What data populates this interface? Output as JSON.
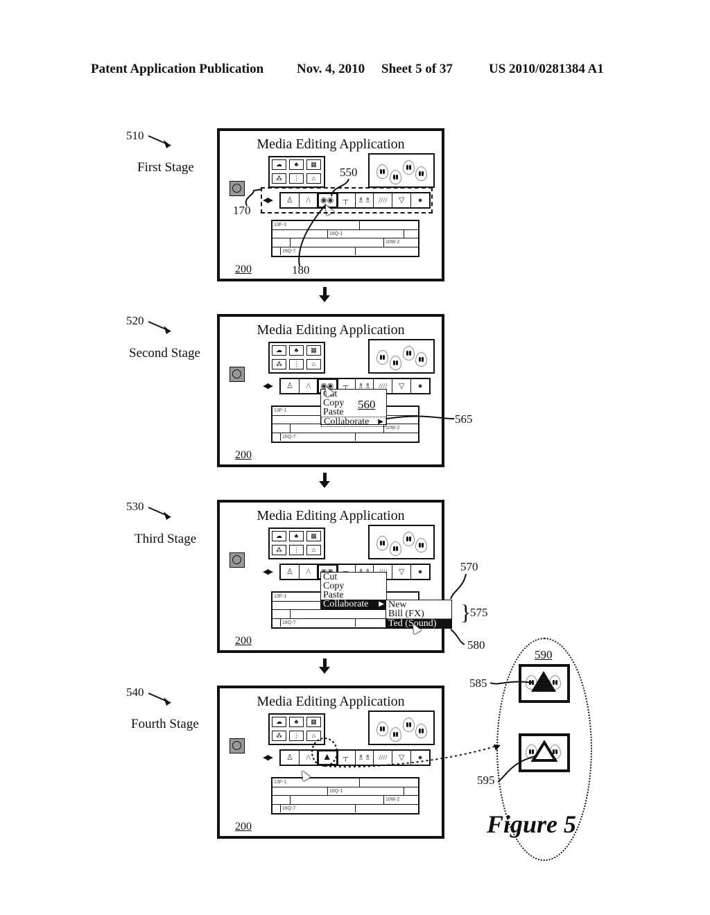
{
  "header": {
    "publication": "Patent Application Publication",
    "date": "Nov. 4, 2010",
    "sheet": "Sheet 5 of 37",
    "number": "US 2010/0281384 A1"
  },
  "app": {
    "title": "Media Editing Application",
    "ref_number": "200",
    "timeline_clips": [
      "13F-1",
      "16Q-1",
      "10W-2",
      "16Q-7"
    ]
  },
  "stages": [
    {
      "ref": "510",
      "label": "First Stage"
    },
    {
      "ref": "520",
      "label": "Second Stage"
    },
    {
      "ref": "530",
      "label": "Third Stage"
    },
    {
      "ref": "540",
      "label": "Fourth Stage"
    }
  ],
  "refs": {
    "r170": "170",
    "r180": "180",
    "r550": "550",
    "r560": "560",
    "r565": "565",
    "r570": "570",
    "r575": "575",
    "r580": "580",
    "r585": "585",
    "r590": "590",
    "r595": "595"
  },
  "context_menu": {
    "items": [
      "Cut",
      "Copy",
      "Paste",
      "Collaborate"
    ],
    "submenu_arrow": "▶"
  },
  "collaborate_submenu": {
    "items": [
      "New",
      "Bill (FX)",
      "Ted (Sound)"
    ],
    "selected": "Ted (Sound)"
  },
  "icons": {
    "nav": "◀▶",
    "thumbs": [
      "person-walking",
      "road",
      "faces",
      "signpost",
      "runners",
      "rain",
      "tornado",
      "eggs"
    ]
  },
  "figure_label": "Figure 5"
}
